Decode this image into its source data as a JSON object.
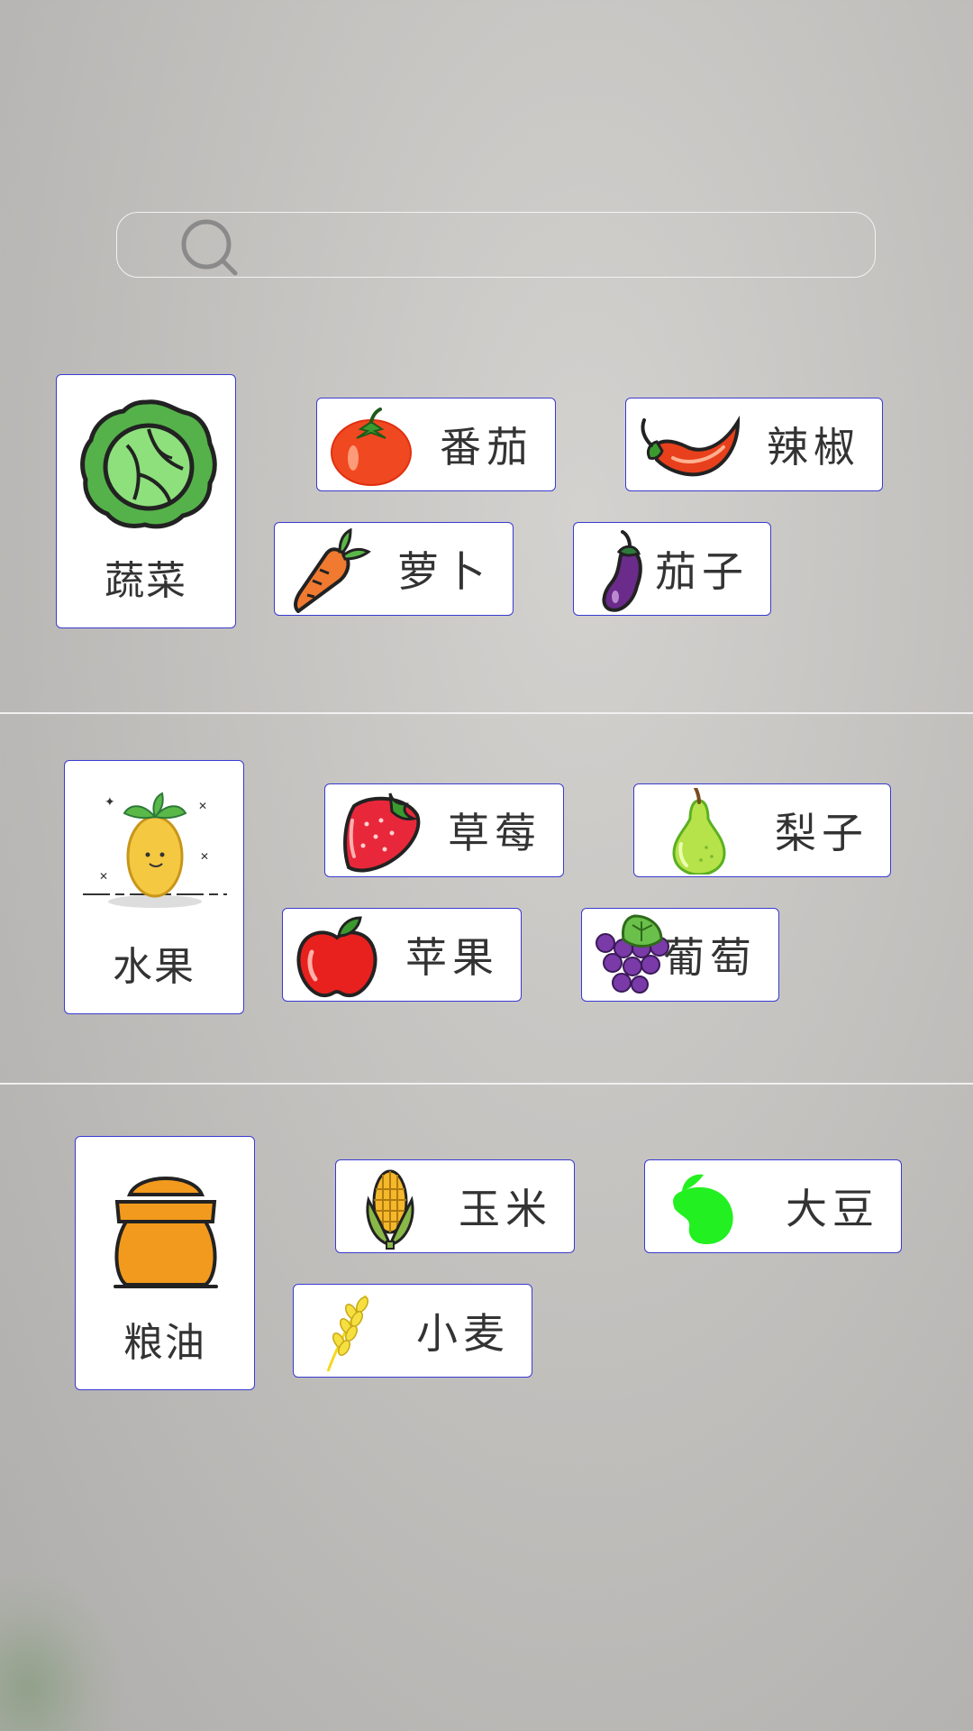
{
  "search": {
    "placeholder": ""
  },
  "sections": [
    {
      "category": "蔬菜",
      "items": [
        "番茄",
        "辣椒",
        "萝卜",
        "茄子"
      ]
    },
    {
      "category": "水果",
      "items": [
        "草莓",
        "梨子",
        "苹果",
        "葡萄"
      ]
    },
    {
      "category": "粮油",
      "items": [
        "玉米",
        "大豆",
        "小麦"
      ]
    }
  ],
  "icons": {
    "vegetables": "cabbage-icon",
    "tomato": "tomato-icon",
    "chili": "chili-pepper-icon",
    "carrot": "carrot-icon",
    "eggplant": "eggplant-icon",
    "fruit": "fruit-illustration-icon",
    "strawberry": "strawberry-icon",
    "pear": "pear-icon",
    "apple": "apple-icon",
    "grape": "grape-icon",
    "grain": "grain-sack-icon",
    "corn": "corn-icon",
    "soybean": "soybean-icon",
    "wheat": "wheat-icon"
  },
  "colors": {
    "card_border": "#3a3ad0",
    "card_background": "#ffffff",
    "text": "#333333"
  }
}
